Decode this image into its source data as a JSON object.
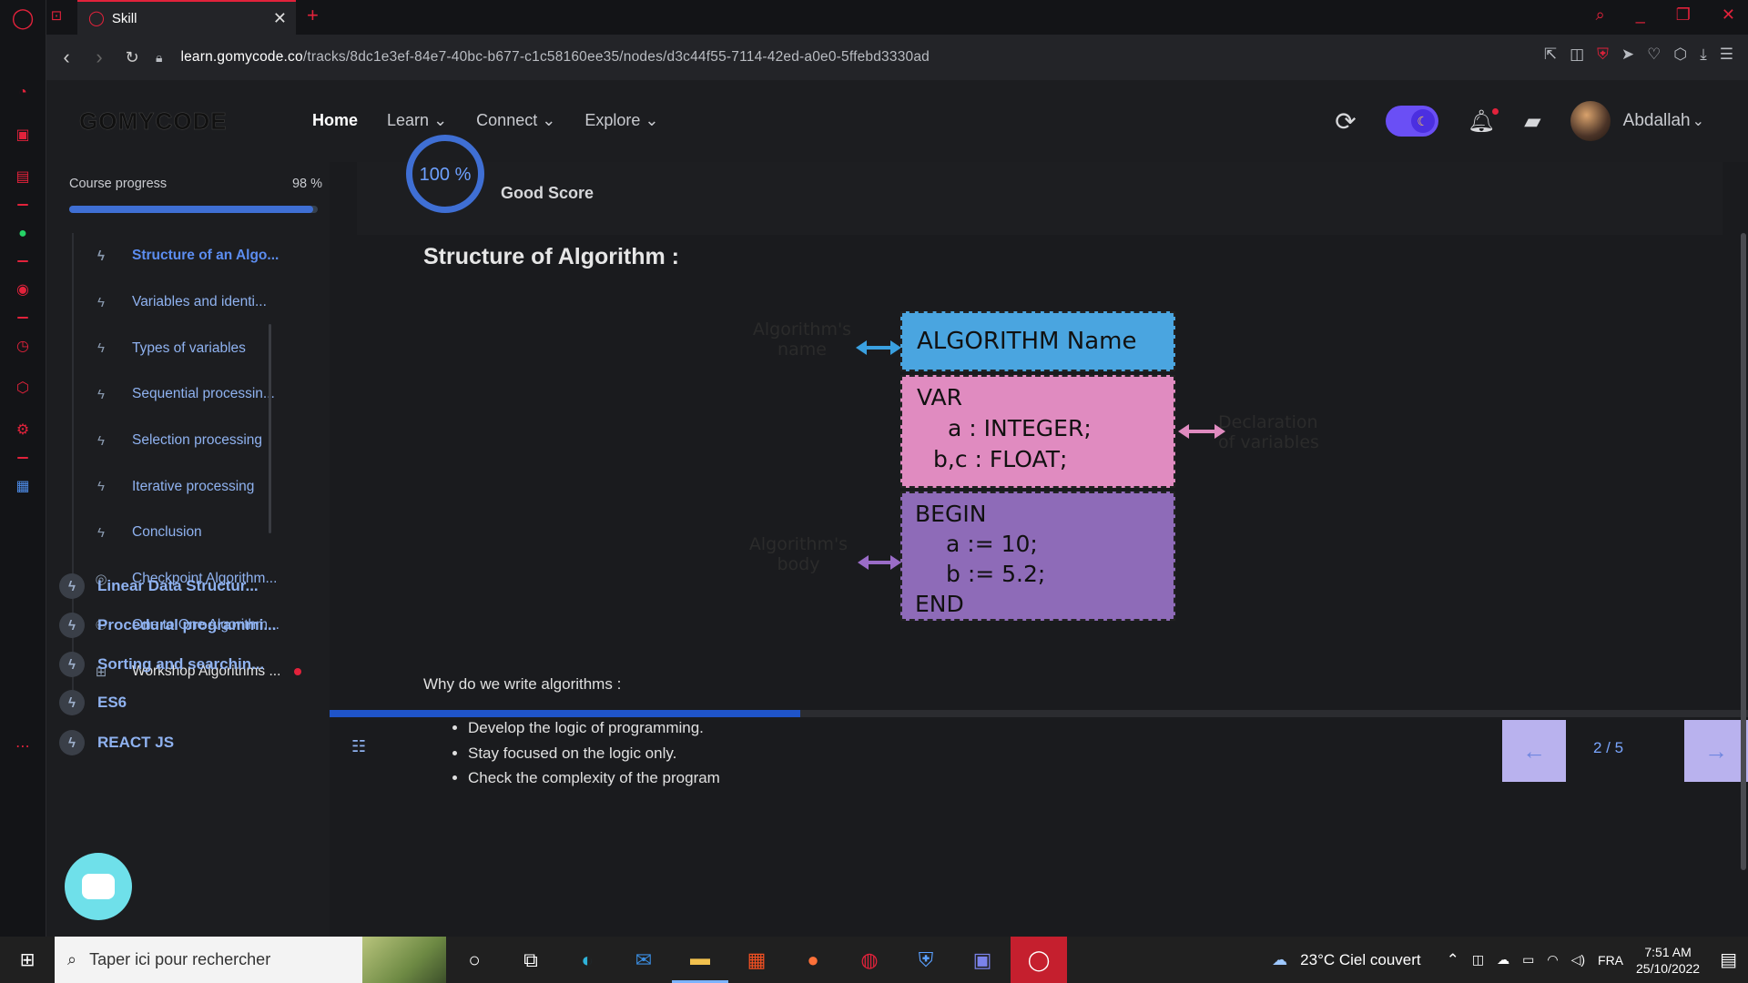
{
  "browser": {
    "tab_title": "Skill",
    "url_domain": "learn.gomycode.co",
    "url_path": "/tracks/8dc1e3ef-84e7-40bc-b677-c1c58160ee35/nodes/d3c44f55-7114-42ed-a0e0-5ffebd3330ad"
  },
  "header": {
    "logo": "GOMYCODE",
    "nav": [
      "Home",
      "Learn",
      "Connect",
      "Explore"
    ],
    "username": "Abdallah"
  },
  "sidebar": {
    "progress_label": "Course progress",
    "progress_value": "98 %",
    "progress_fraction": 0.98,
    "lessons": [
      {
        "label": "Structure of an Algo...",
        "icon": "bolt-icon"
      },
      {
        "label": "Variables and identi...",
        "icon": "bolt-icon"
      },
      {
        "label": "Types of variables",
        "icon": "bolt-icon"
      },
      {
        "label": "Sequential processin...",
        "icon": "bolt-icon"
      },
      {
        "label": "Selection processing",
        "icon": "bolt-icon"
      },
      {
        "label": "Iterative processing",
        "icon": "bolt-icon"
      },
      {
        "label": "Conclusion",
        "icon": "bolt-icon"
      },
      {
        "label": "Checkpoint Algorithm...",
        "icon": "target-icon"
      },
      {
        "label": "One to One Algorithm...",
        "icon": "people-icon"
      },
      {
        "label": "Workshop Algorithms ...",
        "icon": "presentation-icon"
      }
    ],
    "modules": [
      "Linear Data Structur...",
      "Procedural programmi...",
      "Sorting and searchin...",
      "ES6",
      "REACT JS"
    ]
  },
  "content": {
    "score_value": "100 %",
    "score_label": "Good Score",
    "title": "Structure of Algorithm :",
    "diagram": {
      "label_name": "Algorithm's name",
      "label_declaration": "Declaration of variables",
      "label_body": "Algorithm's body",
      "box_name": "ALGORITHM Name",
      "var_lines": [
        "VAR",
        "a : INTEGER;",
        "b,c : FLOAT;"
      ],
      "body_lines": [
        "BEGIN",
        "a := 10;",
        "b := 5.2;",
        "END"
      ]
    },
    "why_title": "Why do we write algorithms :",
    "bullets": [
      "Develop the logic of programming.",
      "Stay focused on the logic only.",
      "Check the complexity of the program"
    ],
    "page_counter": "2 / 5"
  },
  "taskbar": {
    "search_placeholder": "Taper ici pour rechercher",
    "weather": "23°C  Ciel couvert",
    "language": "FRA",
    "time": "7:51 AM",
    "date": "25/10/2022"
  },
  "colors": {
    "accent": "#3f6fd4",
    "opera_red": "#e2223b",
    "box_blue": "#4aa5e0",
    "box_pink": "#e08bc0",
    "box_purple": "#8e6bb8"
  }
}
